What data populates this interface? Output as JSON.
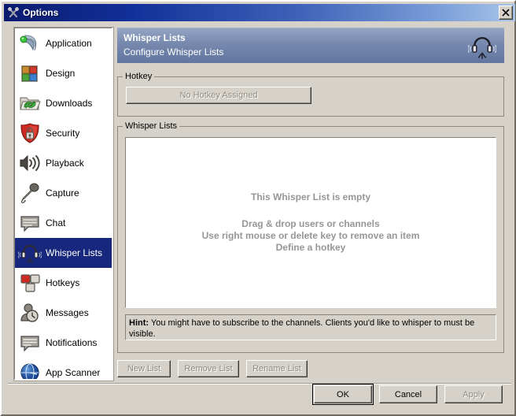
{
  "window": {
    "title": "Options",
    "title_icon": "tools-icon",
    "close_label": "✕"
  },
  "sidebar": {
    "items": [
      {
        "label": "Application",
        "icon": "application-icon",
        "selected": false
      },
      {
        "label": "Design",
        "icon": "design-icon",
        "selected": false
      },
      {
        "label": "Downloads",
        "icon": "downloads-icon",
        "selected": false
      },
      {
        "label": "Security",
        "icon": "security-icon",
        "selected": false
      },
      {
        "label": "Playback",
        "icon": "playback-icon",
        "selected": false
      },
      {
        "label": "Capture",
        "icon": "capture-icon",
        "selected": false
      },
      {
        "label": "Chat",
        "icon": "chat-icon",
        "selected": false
      },
      {
        "label": "Whisper Lists",
        "icon": "headset-icon",
        "selected": true
      },
      {
        "label": "Hotkeys",
        "icon": "hotkeys-icon",
        "selected": false
      },
      {
        "label": "Messages",
        "icon": "messages-icon",
        "selected": false
      },
      {
        "label": "Notifications",
        "icon": "notifications-icon",
        "selected": false
      },
      {
        "label": "App Scanner",
        "icon": "app-scanner-icon",
        "selected": false
      }
    ]
  },
  "banner": {
    "title": "Whisper Lists",
    "subtitle": "Configure Whisper Lists",
    "icon": "headset-icon"
  },
  "hotkey_group": {
    "legend": "Hotkey",
    "button_label": "No Hotkey Assigned"
  },
  "lists_group": {
    "legend": "Whisper Lists",
    "empty_title": "This Whisper List is empty",
    "empty_line_1": "Drag & drop users or channels",
    "empty_line_2": "Use right mouse or delete key to remove an item",
    "empty_line_3": "Define a hotkey",
    "hint_label": "Hint:",
    "hint_text": " You might have to subscribe to the channels. Clients you'd like to whisper to must be visible."
  },
  "list_buttons": {
    "new": "New List",
    "remove": "Remove List",
    "rename": "Rename List"
  },
  "dialog_buttons": {
    "ok": "OK",
    "cancel": "Cancel",
    "apply": "Apply"
  },
  "colors": {
    "face": "#d6d2ca",
    "titlebar_start": "#0a1a6e",
    "titlebar_end": "#a8c4e8",
    "selection": "#17277d",
    "banner": "#7688ad",
    "disabled_text": "#8e8a82",
    "placeholder_text": "#969696"
  }
}
